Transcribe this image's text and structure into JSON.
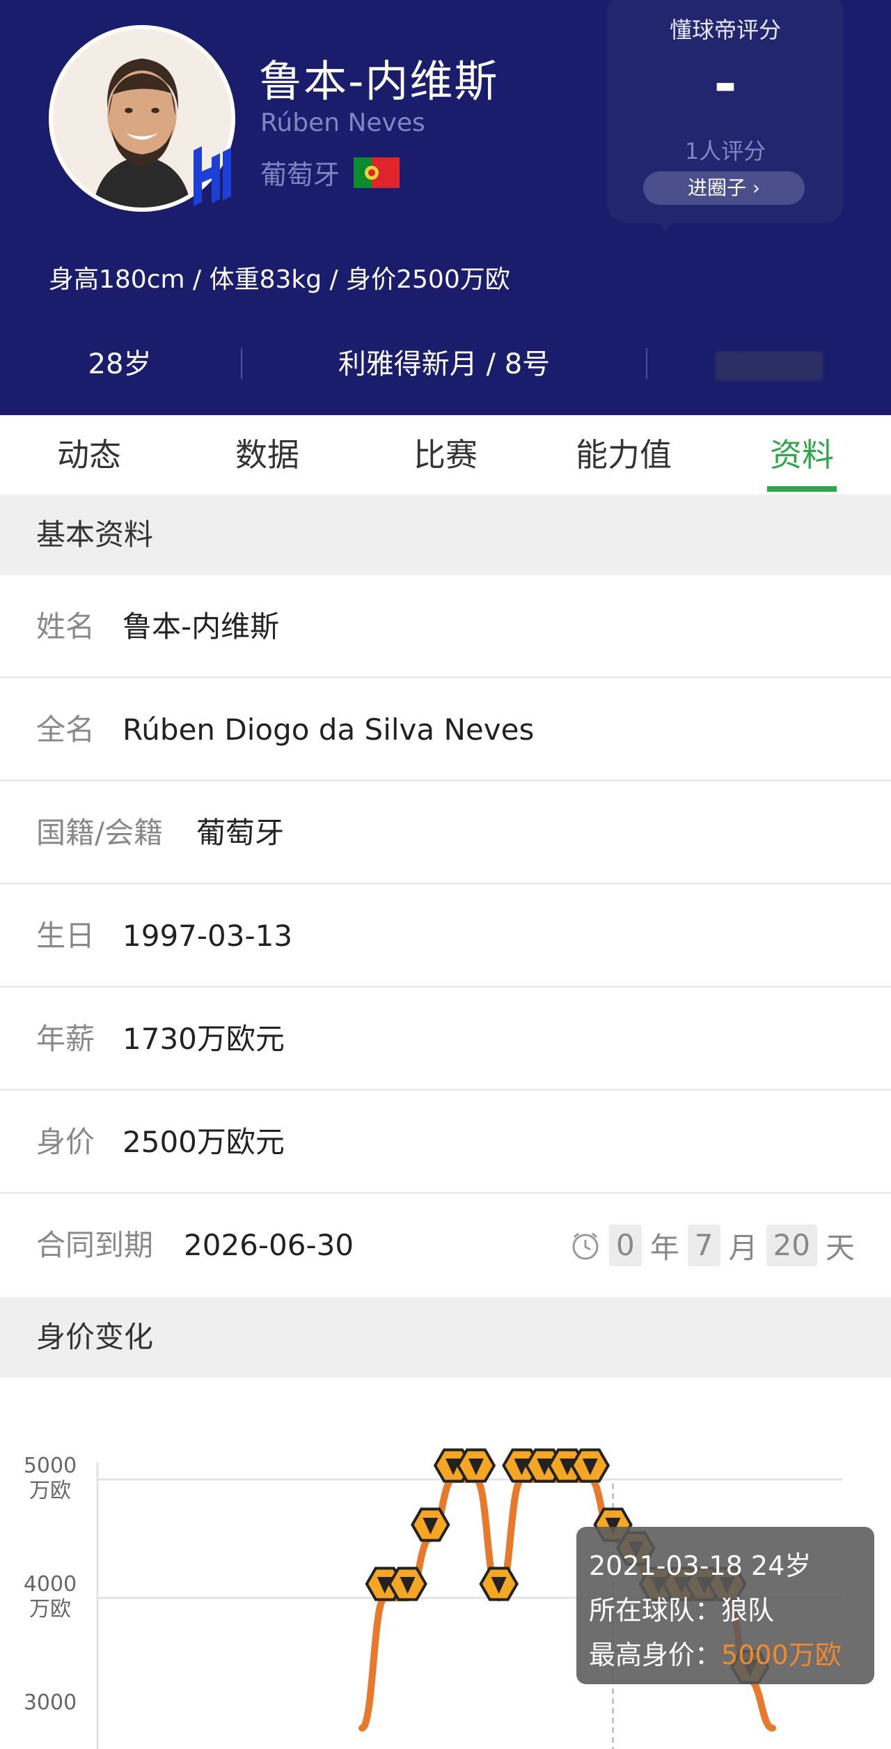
{
  "player": {
    "name_cn": "鲁本-内维斯",
    "name_en": "Rúben Neves",
    "country": "葡萄牙",
    "body_info": "身高180cm / 体重83kg / 身价2500万欧",
    "age": "28岁",
    "club_number": "利雅得新月 / 8号"
  },
  "rating": {
    "title": "懂球帝评分",
    "score": "-",
    "count": "1人评分",
    "button": "进圈子"
  },
  "tabs": [
    "动态",
    "数据",
    "比赛",
    "能力值",
    "资料"
  ],
  "active_tab": "资料",
  "basic": {
    "title": "基本资料",
    "rows": [
      {
        "label": "姓名",
        "value": "鲁本-内维斯"
      },
      {
        "label": "全名",
        "value": "Rúben Diogo da Silva Neves"
      },
      {
        "label": "国籍/会籍",
        "value": "葡萄牙"
      },
      {
        "label": "生日",
        "value": "1997-03-13"
      },
      {
        "label": "年薪",
        "value": "1730万欧元"
      },
      {
        "label": "身价",
        "value": "2500万欧元"
      }
    ],
    "contract": {
      "label": "合同到期",
      "value": "2026-06-30",
      "years": "0",
      "year_unit": "年",
      "months": "7",
      "month_unit": "月",
      "days": "20",
      "day_unit": "天"
    }
  },
  "value_change": {
    "title": "身价变化",
    "tooltip": {
      "date_age": "2021-03-18 24岁",
      "team_label": "所在球队：",
      "team": "狼队",
      "max_label": "最高身价：",
      "max_value": "5000万欧"
    }
  },
  "chart_data": {
    "type": "line",
    "y_ticks": [
      {
        "line1": "5000",
        "line2": "万欧",
        "value": 5000
      },
      {
        "line1": "4000",
        "line2": "万欧",
        "value": 4000
      },
      {
        "line1": "3000",
        "line2": "",
        "value": 3000
      }
    ],
    "ylim": [
      3000,
      5000
    ],
    "series": [
      {
        "points": [
          {
            "x": 0,
            "y": 2900
          },
          {
            "x": 1,
            "y": 4000
          },
          {
            "x": 2,
            "y": 4000
          },
          {
            "x": 3,
            "y": 4500
          },
          {
            "x": 4,
            "y": 5000
          },
          {
            "x": 5,
            "y": 5000
          },
          {
            "x": 6,
            "y": 4000
          },
          {
            "x": 7,
            "y": 5000
          },
          {
            "x": 8,
            "y": 5000
          },
          {
            "x": 9,
            "y": 5000
          },
          {
            "x": 10,
            "y": 5000
          },
          {
            "x": 11,
            "y": 4500
          },
          {
            "x": 12,
            "y": 4300
          },
          {
            "x": 13,
            "y": 4000
          },
          {
            "x": 14,
            "y": 4000
          },
          {
            "x": 15,
            "y": 4000
          },
          {
            "x": 16,
            "y": 4000
          },
          {
            "x": 17,
            "y": 3300
          },
          {
            "x": 18,
            "y": 2900
          }
        ],
        "color": "#e8782a"
      }
    ],
    "highlight_x": 11
  },
  "colors": {
    "header_bg": "#1a1d6b",
    "accent_green": "#2aa84a",
    "line_orange": "#e8782a"
  }
}
